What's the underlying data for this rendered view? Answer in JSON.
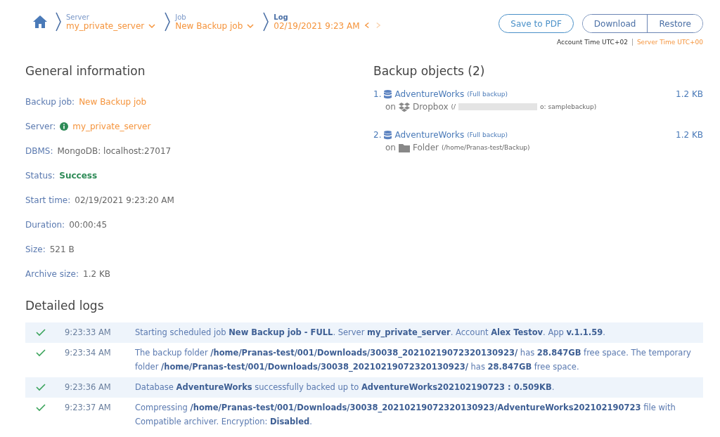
{
  "breadcrumb": [
    {
      "label": "Server",
      "value": "my_private_server",
      "kind": "dropdown"
    },
    {
      "label": "Job",
      "value": "New Backup job",
      "kind": "dropdown"
    },
    {
      "label": "Log",
      "value": "02/19/2021 9:23 AM",
      "kind": "pager",
      "prev_disabled": false,
      "next_disabled": true
    }
  ],
  "actions": {
    "save_pdf": "Save to PDF",
    "group": [
      "Download",
      "Restore"
    ]
  },
  "timezones": {
    "account": "Account Time UTC+02",
    "server": "Server Time UTC+00"
  },
  "general": {
    "title": "General information",
    "fields": [
      {
        "label": "Backup job:",
        "value": "New Backup job",
        "kind": "link"
      },
      {
        "label": "Server:",
        "value": "my_private_server",
        "kind": "server"
      },
      {
        "label": "DBMS:",
        "value": "MongoDB: localhost:27017",
        "kind": "plain"
      },
      {
        "label": "Status:",
        "value": "Success",
        "kind": "success"
      },
      {
        "label": "Start time:",
        "value": "02/19/2021 9:23:20 AM",
        "kind": "plain"
      },
      {
        "label": "Duration:",
        "value": "00:00:45",
        "kind": "plain"
      },
      {
        "label": "Size:",
        "value": "521 B",
        "kind": "plain"
      },
      {
        "label": "Archive size:",
        "value": "1.2 KB",
        "kind": "plain"
      }
    ]
  },
  "backup_objects": {
    "title": "Backup objects (2)",
    "items": [
      {
        "number": "1.",
        "name": "AdventureWorks",
        "type": "(Full backup)",
        "size": "1.2 KB",
        "on": "on",
        "storage": "Dropbox",
        "kind": "dropbox",
        "path_start": "(/",
        "path_end": "o: samplebackup)",
        "redacted": true
      },
      {
        "number": "2.",
        "name": "AdventureWorks",
        "type": "(Full backup)",
        "size": "1.2 KB",
        "on": "on",
        "storage": "Folder",
        "kind": "folder",
        "path_start": "(/home/Pranas-test/Backup)",
        "redacted": false
      }
    ]
  },
  "logs": {
    "title": "Detailed logs",
    "rows": [
      {
        "kind": "success",
        "time": "9:23:33 AM",
        "message": "Starting scheduled job **New Backup job - FULL**. Server **my_private_server**. Account **Alex Testov**. App **v.1.1.59**."
      },
      {
        "kind": "success",
        "time": "9:23:34 AM",
        "message": "The backup folder **/home/Pranas-test/001/Downloads/30038_20210219072320130923/** has **28.847GB** free space. The temporary folder **/home/Pranas-test/001/Downloads/30038_20210219072320130923/** has **28.847GB** free space."
      },
      {
        "kind": "success",
        "time": "9:23:36 AM",
        "message": "Database **AdventureWorks** successfully backed up to **AdventureWorks202102190723 : 0.509KB**."
      },
      {
        "kind": "success",
        "time": "9:23:37 AM",
        "message": "Compressing **/home/Pranas-test/001/Downloads/30038_20210219072320130923/AdventureWorks202102190723** file with Compatible archiver. Encryption: **Disabled**."
      }
    ]
  }
}
